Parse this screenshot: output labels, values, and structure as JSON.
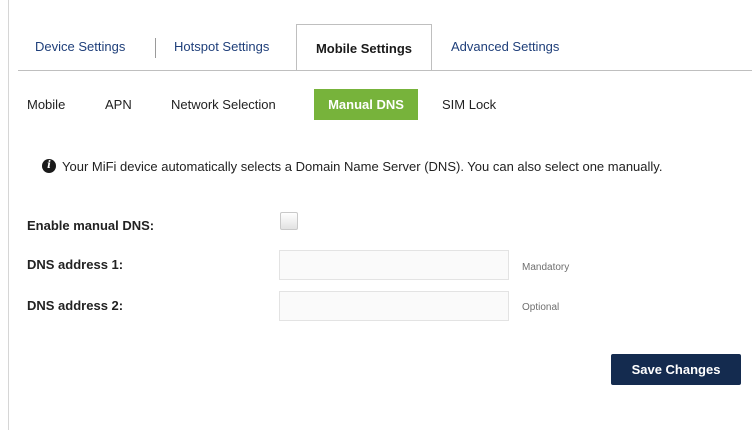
{
  "main_tabs": {
    "device_settings": "Device Settings",
    "hotspot_settings": "Hotspot Settings",
    "mobile_settings": "Mobile Settings",
    "advanced_settings": "Advanced Settings",
    "active": "Mobile Settings"
  },
  "sub_tabs": {
    "mobile": "Mobile",
    "apn": "APN",
    "network_selection": "Network Selection",
    "manual_dns": "Manual DNS",
    "sim_lock": "SIM Lock",
    "active": "Manual DNS"
  },
  "info": {
    "icon": "info-icon",
    "icon_glyph": "i",
    "message": "Your MiFi device automatically selects a Domain Name Server (DNS). You can also select one manually."
  },
  "form": {
    "enable_manual_dns_label": "Enable manual DNS:",
    "enable_manual_dns_checked": false,
    "dns1_label": "DNS address 1:",
    "dns1_value": "",
    "dns1_hint": "Mandatory",
    "dns2_label": "DNS address 2:",
    "dns2_value": "",
    "dns2_hint": "Optional",
    "save_label": "Save Changes"
  },
  "colors": {
    "tab_link": "#1f3f7a",
    "active_subtab": "#77b33b",
    "save_button": "#142b4f"
  }
}
